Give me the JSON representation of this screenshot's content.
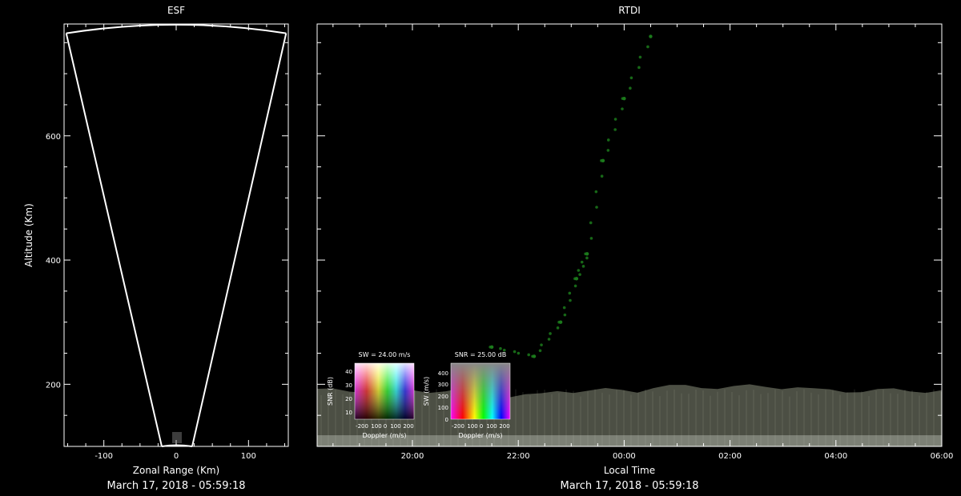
{
  "chart_data": [
    {
      "type": "scatter",
      "title": "ESF",
      "xlabel": "Zonal Range (Km)",
      "ylabel": "Altitude (Km)",
      "footer": "March 17, 2018 - 05:59:18",
      "xlim": [
        -155,
        155
      ],
      "ylim": [
        100,
        780
      ],
      "xticks": [
        -100,
        0,
        100
      ],
      "xtick_labels": [
        "-100",
        "0",
        "100"
      ],
      "yticks": [
        200,
        400,
        600
      ],
      "ytick_labels": [
        "200",
        "400",
        "600"
      ],
      "fan": {
        "apex": [
          0,
          100
        ],
        "left_edge": [
          -152,
          765
        ],
        "right_edge": [
          152,
          765
        ],
        "top": 780
      }
    },
    {
      "type": "heatmap",
      "title": "RTDI",
      "xlabel": "Local Time",
      "footer": "March 17, 2018 - 05:59:18",
      "x_range_hours": [
        18.2,
        30.0
      ],
      "ylim": [
        100,
        780
      ],
      "xticks": [
        20,
        22,
        24,
        26,
        28,
        30
      ],
      "xtick_labels": [
        "20:00",
        "22:00",
        "00:00",
        "02:00",
        "04:00",
        "06:00"
      ],
      "echo_band": {
        "alt_base": 100,
        "alt_top_typ": 190,
        "color": "#8a8f7c"
      },
      "plume": {
        "color": "#1b7a1b",
        "points": [
          [
            21.5,
            260
          ],
          [
            22.3,
            245
          ],
          [
            22.8,
            300
          ],
          [
            23.1,
            370
          ],
          [
            23.3,
            410
          ],
          [
            23.6,
            560
          ],
          [
            24.0,
            660
          ],
          [
            24.5,
            760
          ]
        ]
      },
      "legends": [
        {
          "caption": "SW = 24.00 m/s",
          "xlabel": "Doppler (m/s)",
          "ylabel": "SNR (dB)",
          "xticks": [
            "-200",
            "100",
            "0",
            "100",
            "200"
          ],
          "yticks": [
            "10",
            "20",
            "30",
            "40"
          ]
        },
        {
          "caption": "SNR = 25.00 dB",
          "xlabel": "Doppler (m/s)",
          "ylabel": "SW (m/s)",
          "xticks": [
            "-200",
            "100",
            "0",
            "100",
            "200"
          ],
          "yticks": [
            "0",
            "100",
            "200",
            "300",
            "400"
          ]
        }
      ]
    }
  ]
}
